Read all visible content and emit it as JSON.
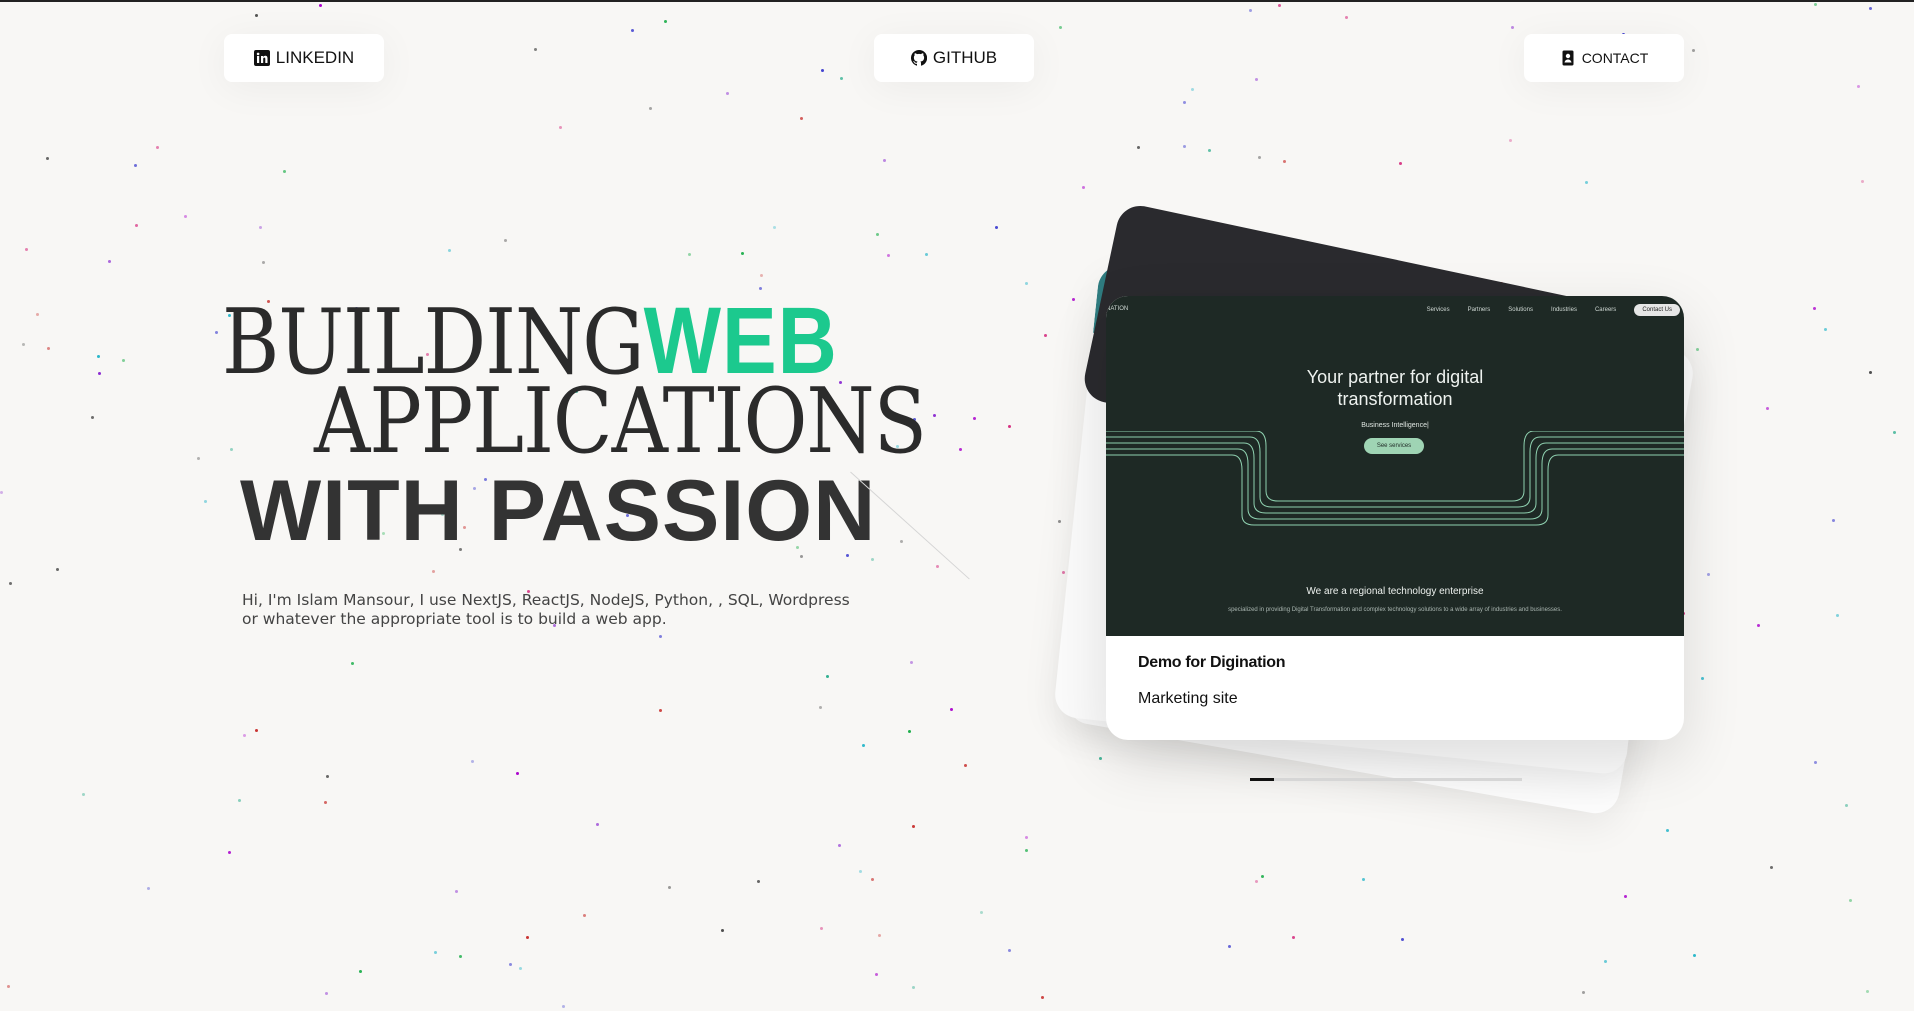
{
  "nav": {
    "linkedin_label": "LINKEDIN",
    "github_label": "GITHUB",
    "contact_label": "CONTACT"
  },
  "hero": {
    "line1_serif": "BUILDING",
    "line1_accent": "WEB",
    "line2": "APPLICATIONS",
    "line3": "WITH PASSION",
    "intro": "Hi, I'm Islam Mansour, I use NextJS, ReactJS, NodeJS, Python, , SQL, Wordpress or whatever the appropriate tool is to build a web app."
  },
  "project_card": {
    "title": "Demo for Digination",
    "subtitle": "Marketing site",
    "preview": {
      "logo": "NATION",
      "nav": [
        "Services",
        "Partners",
        "Solutions",
        "Industries",
        "Careers"
      ],
      "nav_cta": "Contact Us",
      "headline_1": "Your partner for digital",
      "headline_2": "transformation",
      "subline": "Business Intelligence|",
      "button": "See services",
      "section_title": "We are a regional technology enterprise",
      "section_text": "specialized in providing Digital Transformation and complex technology solutions to a wide array of industries and businesses."
    }
  },
  "carousel": {
    "progress": 0.09
  },
  "colors": {
    "accent": "#1cc98e",
    "background": "#f8f7f5",
    "preview_bg": "#1e2925"
  }
}
